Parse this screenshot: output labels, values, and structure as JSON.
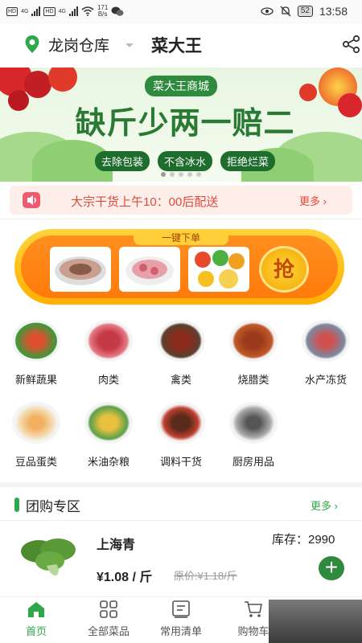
{
  "status_bar": {
    "hd1": "HD",
    "net1": "4G",
    "hd2": "HD",
    "net2": "4G",
    "speed_value": "171",
    "speed_unit": "B/s",
    "battery": "52",
    "time": "13:58"
  },
  "header": {
    "location": "龙岗仓库",
    "shop_name": "菜大王"
  },
  "banner": {
    "badge": "菜大王商城",
    "slogan": "缺斤少两一赔二",
    "tags": [
      "去除包装",
      "不含冰水",
      "拒绝烂菜"
    ]
  },
  "notice": {
    "text": "大宗干货上午10：00后配送",
    "more": "更多"
  },
  "quick_order": {
    "label": "一键下单",
    "button": "抢"
  },
  "categories": [
    {
      "label": "新鲜蔬果",
      "icon": "vegetables-fruit-icon"
    },
    {
      "label": "肉类",
      "icon": "meat-icon"
    },
    {
      "label": "禽类",
      "icon": "poultry-icon"
    },
    {
      "label": "烧腊类",
      "icon": "roast-meat-icon"
    },
    {
      "label": "水产冻货",
      "icon": "seafood-icon"
    },
    {
      "label": "豆品蛋类",
      "icon": "egg-icon"
    },
    {
      "label": "米油杂粮",
      "icon": "rice-oil-icon"
    },
    {
      "label": "调料干货",
      "icon": "seasoning-icon"
    },
    {
      "label": "厨房用品",
      "icon": "kitchen-icon"
    }
  ],
  "group_buy": {
    "title": "团购专区",
    "more": "更多",
    "product": {
      "name": "上海青",
      "stock": "库存：2990",
      "price": "¥1.08 / 斤",
      "original_price": "原价:¥1.18/斤"
    }
  },
  "tabs": [
    {
      "label": "首页",
      "icon": "home-icon",
      "active": true
    },
    {
      "label": "全部菜品",
      "icon": "grid-icon",
      "active": false
    },
    {
      "label": "常用清单",
      "icon": "list-icon",
      "active": false
    },
    {
      "label": "购物车",
      "icon": "cart-icon",
      "active": false
    }
  ],
  "colors": {
    "brand_green": "#2ea84a",
    "notice_red": "#e04a3a",
    "order_orange": "#ff8f1f"
  }
}
